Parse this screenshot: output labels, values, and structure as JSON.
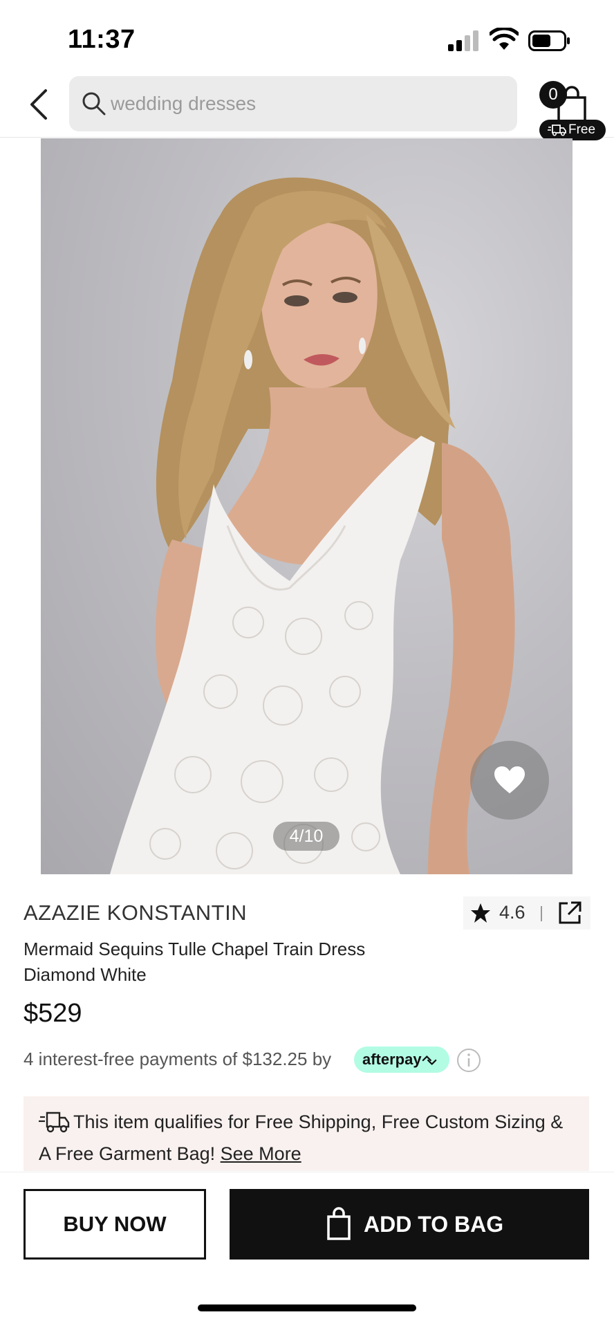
{
  "status_bar": {
    "time": "11:37"
  },
  "header": {
    "search": {
      "placeholder": "wedding dresses"
    },
    "cart": {
      "count": "0",
      "free_label": "Free"
    }
  },
  "gallery": {
    "counter": "4/10"
  },
  "product": {
    "brand": "AZAZIE KONSTANTIN",
    "rating": "4.6",
    "title_line1": "Mermaid Sequins Tulle Chapel Train Dress",
    "title_line2": "Diamond White",
    "price": "$529",
    "afterpay_text": "4 interest-free payments of $132.25 by",
    "afterpay_brand": "afterpay"
  },
  "shipping_banner": {
    "text": "This item qualifies for Free Shipping, Free Custom Sizing & A Free Garment Bag!",
    "link": "See More"
  },
  "actions": {
    "buy_now": "BUY NOW",
    "add_to_bag": "ADD TO BAG"
  },
  "colors": {
    "afterpay_mint": "#b2fce4",
    "banner_bg": "#f9f1ef",
    "primary": "#111111"
  }
}
